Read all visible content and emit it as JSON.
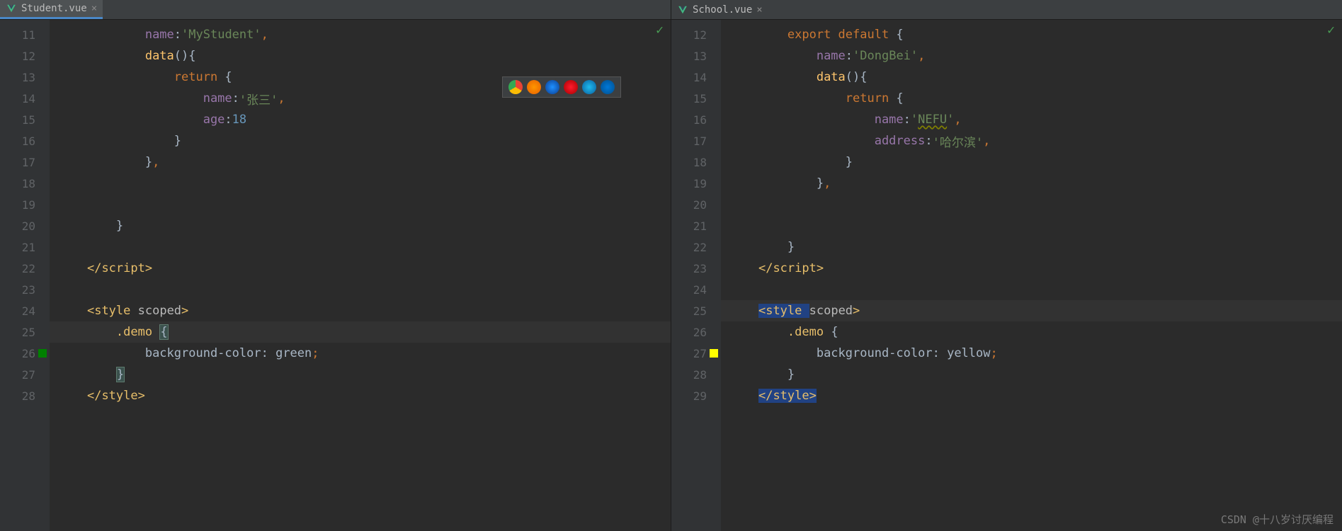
{
  "left": {
    "tab": {
      "name": "Student.vue"
    },
    "startLine": 11,
    "code": [
      {
        "tokens": [
          [
            "            ",
            "plain"
          ],
          [
            "name",
            "prop"
          ],
          [
            ":",
            "plain"
          ],
          [
            "'MyStudent'",
            "str"
          ],
          [
            ",",
            "punc"
          ]
        ]
      },
      {
        "tokens": [
          [
            "            ",
            "plain"
          ],
          [
            "data",
            "fn"
          ],
          [
            "(){",
            "plain"
          ]
        ]
      },
      {
        "tokens": [
          [
            "                ",
            "plain"
          ],
          [
            "return ",
            "kw"
          ],
          [
            "{",
            "plain"
          ]
        ]
      },
      {
        "tokens": [
          [
            "                    ",
            "plain"
          ],
          [
            "name",
            "prop"
          ],
          [
            ":",
            "plain"
          ],
          [
            "'张三'",
            "str"
          ],
          [
            ",",
            "punc"
          ]
        ]
      },
      {
        "tokens": [
          [
            "                    ",
            "plain"
          ],
          [
            "age",
            "prop"
          ],
          [
            ":",
            "plain"
          ],
          [
            "18",
            "num"
          ]
        ]
      },
      {
        "tokens": [
          [
            "                ",
            "plain"
          ],
          [
            "}",
            "plain"
          ]
        ]
      },
      {
        "tokens": [
          [
            "            ",
            "plain"
          ],
          [
            "}",
            "plain"
          ],
          [
            ",",
            "punc"
          ]
        ]
      },
      {
        "tokens": [
          [
            "",
            "plain"
          ]
        ]
      },
      {
        "tokens": [
          [
            "",
            "plain"
          ]
        ]
      },
      {
        "tokens": [
          [
            "        ",
            "plain"
          ],
          [
            "}",
            "plain"
          ]
        ]
      },
      {
        "tokens": [
          [
            "",
            "plain"
          ]
        ]
      },
      {
        "tokens": [
          [
            "    ",
            "plain"
          ],
          [
            "</",
            "tag"
          ],
          [
            "script",
            "tag"
          ],
          [
            ">",
            "tag"
          ]
        ]
      },
      {
        "tokens": [
          [
            "",
            "plain"
          ]
        ]
      },
      {
        "tokens": [
          [
            "    ",
            "plain"
          ],
          [
            "<",
            "tag"
          ],
          [
            "style ",
            "tag"
          ],
          [
            "scoped",
            "attr"
          ],
          [
            ">",
            "tag"
          ]
        ]
      },
      {
        "tokens": [
          [
            "        ",
            "plain"
          ],
          [
            ".demo ",
            "css-sel"
          ],
          [
            "{",
            "brace-match"
          ]
        ],
        "highlight": true
      },
      {
        "tokens": [
          [
            "            ",
            "plain"
          ],
          [
            "background-color",
            "css-prop"
          ],
          [
            ": ",
            "plain"
          ],
          [
            "green",
            "css-val"
          ],
          [
            ";",
            "punc"
          ]
        ],
        "swatch": "green"
      },
      {
        "tokens": [
          [
            "        ",
            "plain"
          ],
          [
            "}",
            "brace-match"
          ]
        ]
      },
      {
        "tokens": [
          [
            "    ",
            "plain"
          ],
          [
            "</",
            "tag"
          ],
          [
            "style",
            "tag"
          ],
          [
            ">",
            "tag"
          ]
        ]
      }
    ]
  },
  "right": {
    "tab": {
      "name": "School.vue"
    },
    "startLine": 12,
    "code": [
      {
        "tokens": [
          [
            "        ",
            "plain"
          ],
          [
            "export default ",
            "kw"
          ],
          [
            "{",
            "plain"
          ]
        ]
      },
      {
        "tokens": [
          [
            "            ",
            "plain"
          ],
          [
            "name",
            "prop"
          ],
          [
            ":",
            "plain"
          ],
          [
            "'DongBei'",
            "str"
          ],
          [
            ",",
            "punc"
          ]
        ]
      },
      {
        "tokens": [
          [
            "            ",
            "plain"
          ],
          [
            "data",
            "fn"
          ],
          [
            "(){",
            "plain"
          ]
        ]
      },
      {
        "tokens": [
          [
            "                ",
            "plain"
          ],
          [
            "return ",
            "kw"
          ],
          [
            "{",
            "plain"
          ]
        ]
      },
      {
        "tokens": [
          [
            "                    ",
            "plain"
          ],
          [
            "name",
            "prop"
          ],
          [
            ":",
            "plain"
          ],
          [
            "'",
            "str"
          ],
          [
            "NEFU",
            "str-warn"
          ],
          [
            "'",
            "str"
          ],
          [
            ",",
            "punc"
          ]
        ]
      },
      {
        "tokens": [
          [
            "                    ",
            "plain"
          ],
          [
            "address",
            "prop"
          ],
          [
            ":",
            "plain"
          ],
          [
            "'哈尔滨'",
            "str"
          ],
          [
            ",",
            "punc"
          ]
        ]
      },
      {
        "tokens": [
          [
            "                ",
            "plain"
          ],
          [
            "}",
            "plain"
          ]
        ]
      },
      {
        "tokens": [
          [
            "            ",
            "plain"
          ],
          [
            "}",
            "plain"
          ],
          [
            ",",
            "punc"
          ]
        ]
      },
      {
        "tokens": [
          [
            "",
            "plain"
          ]
        ]
      },
      {
        "tokens": [
          [
            "",
            "plain"
          ]
        ]
      },
      {
        "tokens": [
          [
            "        ",
            "plain"
          ],
          [
            "}",
            "plain"
          ]
        ]
      },
      {
        "tokens": [
          [
            "    ",
            "plain"
          ],
          [
            "</",
            "tag"
          ],
          [
            "script",
            "tag"
          ],
          [
            ">",
            "tag"
          ]
        ]
      },
      {
        "tokens": [
          [
            "",
            "plain"
          ]
        ]
      },
      {
        "tokens": [
          [
            "    ",
            "plain"
          ],
          [
            "<",
            "tag-sel"
          ],
          [
            "style ",
            "tag-sel"
          ],
          [
            "scoped",
            "attr"
          ],
          [
            ">",
            "tag"
          ]
        ],
        "highlight": true
      },
      {
        "tokens": [
          [
            "        ",
            "plain"
          ],
          [
            ".demo ",
            "css-sel"
          ],
          [
            "{",
            "plain"
          ]
        ]
      },
      {
        "tokens": [
          [
            "            ",
            "plain"
          ],
          [
            "background-color",
            "css-prop"
          ],
          [
            ": ",
            "plain"
          ],
          [
            "yellow",
            "css-val"
          ],
          [
            ";",
            "punc"
          ]
        ],
        "swatch": "yellow"
      },
      {
        "tokens": [
          [
            "        ",
            "plain"
          ],
          [
            "}",
            "plain"
          ]
        ]
      },
      {
        "tokens": [
          [
            "    ",
            "plain"
          ],
          [
            "</",
            "tag-sel"
          ],
          [
            "style",
            "tag-sel"
          ],
          [
            ">",
            "tag-sel"
          ]
        ]
      }
    ]
  },
  "watermark": "CSDN @十八岁讨厌编程",
  "browsers": [
    "chrome",
    "firefox",
    "safari",
    "opera",
    "ie",
    "edge"
  ]
}
